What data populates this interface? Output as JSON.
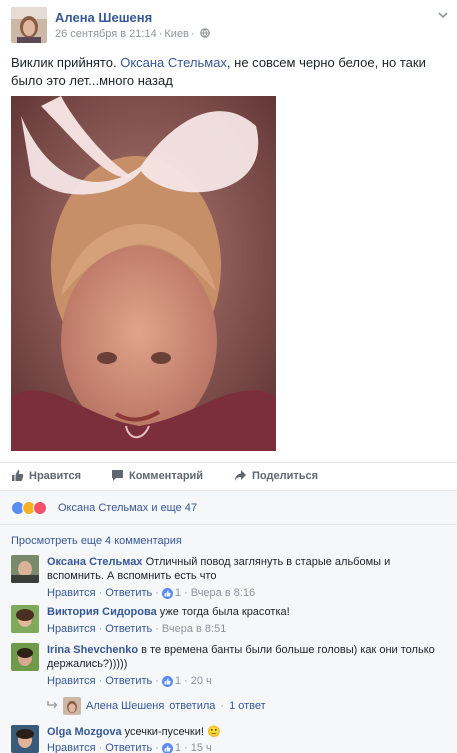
{
  "post": {
    "author": "Алена Шешеня",
    "date": "26 сентября в 21:14",
    "location": "Киев",
    "text_intro": "Виклик прийнято.",
    "mention": "Оксана Стельмах",
    "text_rest": ", не совсем черно белое, но таки было это лет...много назад"
  },
  "actions": {
    "like": "Нравится",
    "comment": "Комментарий",
    "share": "Поделиться"
  },
  "reactions": {
    "summary": "Оксана Стельмах и еще 47"
  },
  "comments_section": {
    "view_more": "Просмотреть еще 4 комментария",
    "like_label": "Нравится",
    "reply_label": "Ответить",
    "items": [
      {
        "name": "Оксана Стельмах",
        "text": "Отличный повод заглянуть в старые альбомы и вспомнить. А вспомнить есть что",
        "likes": "1",
        "time": "Вчера в 8:16"
      },
      {
        "name": "Виктория Сидорова",
        "text": "уже тогда была красотка!",
        "likes": "",
        "time": "Вчера в 8:51"
      },
      {
        "name": "Irina Shevchenko",
        "text": "в те времена банты были больше головы) как они только держались?)))))",
        "likes": "1",
        "time": "20 ч"
      },
      {
        "name": "Olga Mozgova",
        "text": "усечки-пусечки! 🙂",
        "likes": "1",
        "time": "15 ч"
      }
    ],
    "reply_summary": {
      "replier": "Алена Шешеня",
      "action": "ответила",
      "count": "1 ответ"
    }
  },
  "colors": {
    "link": "#365899",
    "meta": "#90949c",
    "like_blue": "#598bf3",
    "panel_bg": "#f6f7f9"
  }
}
